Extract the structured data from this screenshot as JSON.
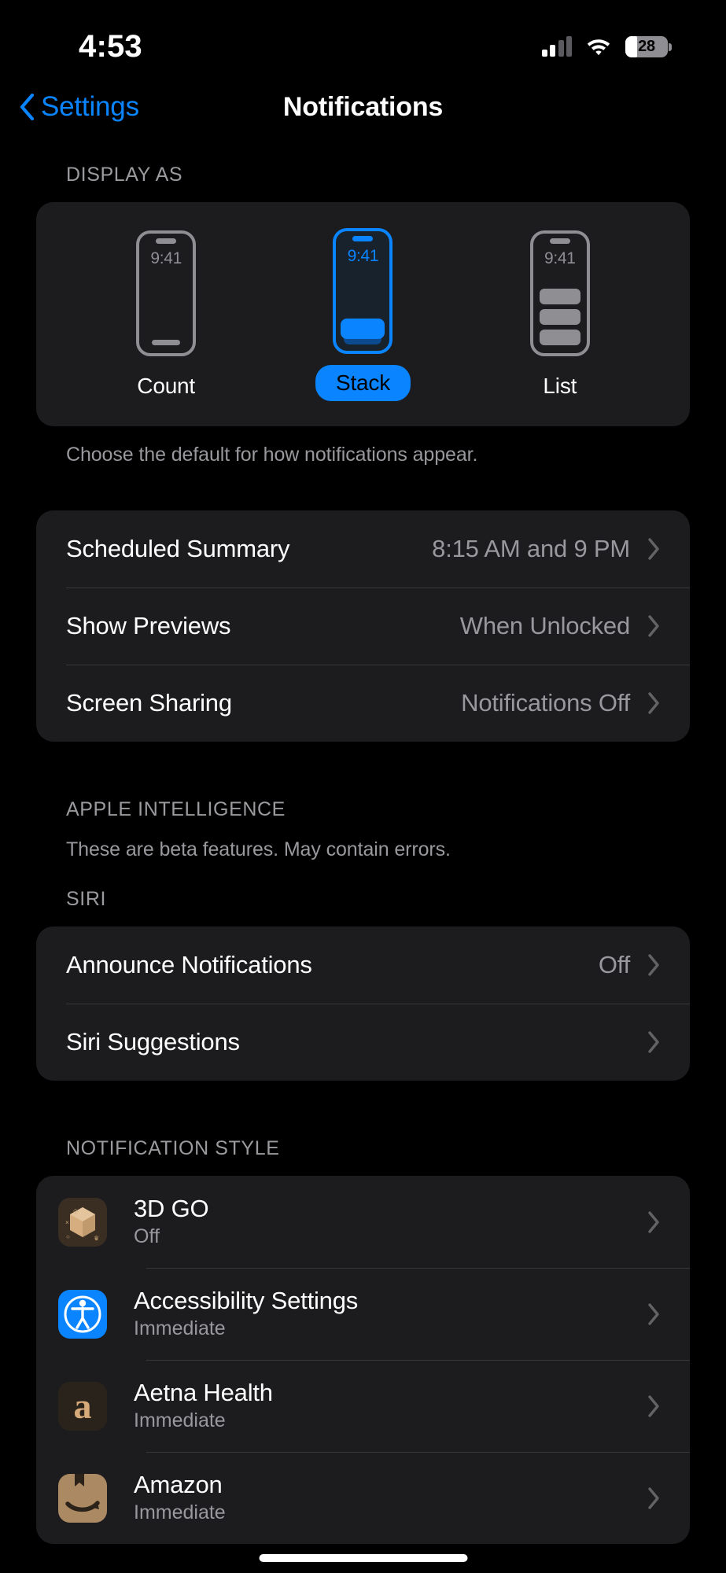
{
  "status_bar": {
    "time": "4:53",
    "battery_percent": "28",
    "cellular_icon": "cellular-signal-icon",
    "wifi_icon": "wifi-icon",
    "battery_icon": "battery-icon"
  },
  "nav": {
    "back_label": "Settings",
    "title": "Notifications"
  },
  "display_as": {
    "header": "DISPLAY AS",
    "footer": "Choose the default for how notifications appear.",
    "phone_time": "9:41",
    "options": [
      {
        "label": "Count",
        "selected": false
      },
      {
        "label": "Stack",
        "selected": true
      },
      {
        "label": "List",
        "selected": false
      }
    ]
  },
  "settings_rows": [
    {
      "label": "Scheduled Summary",
      "value": "8:15 AM and 9 PM"
    },
    {
      "label": "Show Previews",
      "value": "When Unlocked"
    },
    {
      "label": "Screen Sharing",
      "value": "Notifications Off"
    }
  ],
  "apple_intelligence": {
    "header": "APPLE INTELLIGENCE",
    "footer": "These are beta features. May contain errors."
  },
  "siri": {
    "header": "SIRI",
    "rows": [
      {
        "label": "Announce Notifications",
        "value": "Off"
      },
      {
        "label": "Siri Suggestions",
        "value": ""
      }
    ]
  },
  "notification_style": {
    "header": "NOTIFICATION STYLE",
    "apps": [
      {
        "name": "3D GO",
        "status": "Off",
        "icon": "3d-go-app-icon"
      },
      {
        "name": "Accessibility Settings",
        "status": "Immediate",
        "icon": "accessibility-app-icon"
      },
      {
        "name": "Aetna Health",
        "status": "Immediate",
        "icon": "aetna-health-app-icon",
        "glyph": "a"
      },
      {
        "name": "Amazon",
        "status": "Immediate",
        "icon": "amazon-app-icon"
      }
    ]
  },
  "colors": {
    "accent": "#0a84ff",
    "card": "#1c1c1e",
    "background": "#000000",
    "secondary_text": "#98989d",
    "separator": "#38383a"
  }
}
